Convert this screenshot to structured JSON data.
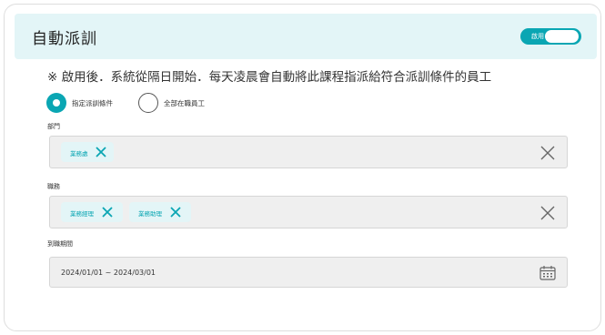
{
  "header": {
    "title": "自動派訓",
    "toggle_label": "啟用"
  },
  "note": "※ 啟用後．系統從隔日開始．每天凌晨會自動將此課程指派給符合派訓條件的員工",
  "radios": {
    "option1": "指定派訓條件",
    "option2": "全部在職員工",
    "selected": "指定派訓條件"
  },
  "department": {
    "label": "部門",
    "chips": [
      "業務處"
    ]
  },
  "position": {
    "label": "職務",
    "chips": [
      "業務經理",
      "業務助理"
    ]
  },
  "onboard_date": {
    "label": "到職期間",
    "value": "2024/01/01 ~ 2024/03/01"
  },
  "colors": {
    "accent": "#0aa6b3",
    "header_bg": "#e3f5f7",
    "field_bg": "#efefef"
  }
}
